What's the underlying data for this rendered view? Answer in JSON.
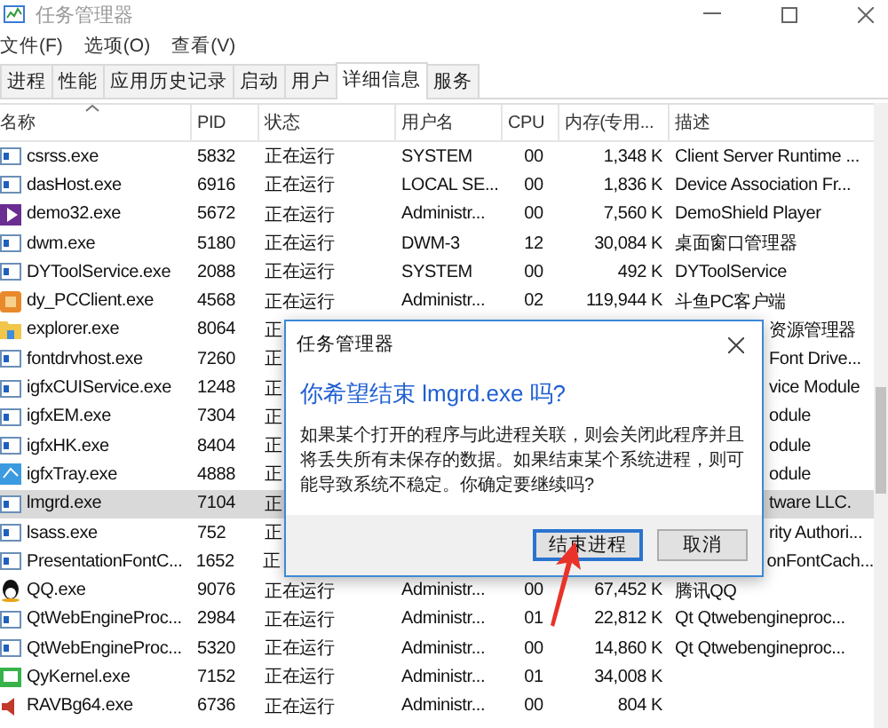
{
  "window": {
    "title": "任务管理器"
  },
  "menu": [
    "文件(F)",
    "选项(O)",
    "查看(V)"
  ],
  "tabs": [
    {
      "label": "进程",
      "selected": false
    },
    {
      "label": "性能",
      "selected": false
    },
    {
      "label": "应用历史记录",
      "selected": false
    },
    {
      "label": "启动",
      "selected": false
    },
    {
      "label": "用户",
      "selected": false
    },
    {
      "label": "详细信息",
      "selected": true
    },
    {
      "label": "服务",
      "selected": false
    }
  ],
  "table": {
    "columns": [
      "名称",
      "PID",
      "状态",
      "用户名",
      "CPU",
      "内存(专用...",
      "描述"
    ],
    "rows": [
      {
        "kind": "window",
        "name": "csrss.exe",
        "pid": "5832",
        "status": "正在运行",
        "user": "SYSTEM",
        "cpu": "00",
        "memory": "1,348 K",
        "description": "Client Server Runtime ...",
        "selected": false
      },
      {
        "kind": "window",
        "name": "dasHost.exe",
        "pid": "6916",
        "status": "正在运行",
        "user": "LOCAL SE...",
        "cpu": "00",
        "memory": "1,836 K",
        "description": "Device Association Fr...",
        "selected": false
      },
      {
        "kind": "play",
        "name": "demo32.exe",
        "pid": "5672",
        "status": "正在运行",
        "user": "Administr...",
        "cpu": "00",
        "memory": "7,560 K",
        "description": "DemoShield Player",
        "selected": false
      },
      {
        "kind": "window",
        "name": "dwm.exe",
        "pid": "5180",
        "status": "正在运行",
        "user": "DWM-3",
        "cpu": "12",
        "memory": "30,084 K",
        "description": "桌面窗口管理器",
        "selected": false
      },
      {
        "kind": "window",
        "name": "DYToolService.exe",
        "pid": "2088",
        "status": "正在运行",
        "user": "SYSTEM",
        "cpu": "00",
        "memory": "492 K",
        "description": "DYToolService",
        "selected": false
      },
      {
        "kind": "box",
        "name": "dy_PCClient.exe",
        "pid": "4568",
        "status": "正在运行",
        "user": "Administr...",
        "cpu": "02",
        "memory": "119,944 K",
        "description": "斗鱼PC客户端",
        "selected": false
      },
      {
        "kind": "folder",
        "name": "explorer.exe",
        "pid": "8064",
        "status": "正",
        "description": "资源管理器",
        "selected": false
      },
      {
        "kind": "window",
        "name": "fontdrvhost.exe",
        "pid": "7260",
        "status": "正",
        "description": "Font Drive...",
        "selected": false
      },
      {
        "kind": "window",
        "name": "igfxCUIService.exe",
        "pid": "1248",
        "status": "正",
        "description": "vice Module",
        "selected": false
      },
      {
        "kind": "window",
        "name": "igfxEM.exe",
        "pid": "7304",
        "status": "正",
        "description": "odule",
        "selected": false
      },
      {
        "kind": "window",
        "name": "igfxHK.exe",
        "pid": "8404",
        "status": "正",
        "description": "odule",
        "selected": false
      },
      {
        "kind": "monitor",
        "name": "igfxTray.exe",
        "pid": "4888",
        "status": "正",
        "description": "odule",
        "selected": false
      },
      {
        "kind": "window",
        "name": "lmgrd.exe",
        "pid": "7104",
        "status": "正",
        "description": "tware LLC.",
        "selected": true
      },
      {
        "kind": "window",
        "name": "lsass.exe",
        "pid": "752",
        "status": "正",
        "description": "rity Authori...",
        "selected": false
      },
      {
        "kind": "window",
        "name": "PresentationFontC...",
        "pid": "1652",
        "status": "正",
        "description": "onFontCach...",
        "selected": false
      },
      {
        "kind": "penguin",
        "name": "QQ.exe",
        "pid": "9076",
        "status": "正在运行",
        "user": "Administr...",
        "cpu": "00",
        "memory": "67,452 K",
        "description": "腾讯QQ",
        "selected": false
      },
      {
        "kind": "window",
        "name": "QtWebEngineProc...",
        "pid": "2984",
        "status": "正在运行",
        "user": "Administr...",
        "cpu": "01",
        "memory": "22,812 K",
        "description": "Qt Qtwebengineproc...",
        "selected": false
      },
      {
        "kind": "window",
        "name": "QtWebEngineProc...",
        "pid": "5320",
        "status": "正在运行",
        "user": "Administr...",
        "cpu": "00",
        "memory": "14,860 K",
        "description": "Qt Qtwebengineproc...",
        "selected": false
      },
      {
        "kind": "screen",
        "name": "QyKernel.exe",
        "pid": "7152",
        "status": "正在运行",
        "user": "Administr...",
        "cpu": "01",
        "memory": "34,008 K",
        "selected": false
      },
      {
        "kind": "speaker",
        "name": "RAVBg64.exe",
        "pid": "6736",
        "status": "正在运行",
        "user": "Administr...",
        "cpu": "00",
        "memory": "804 K",
        "selected": false
      }
    ]
  },
  "dialog": {
    "title": "任务管理器",
    "heading": "你希望结束 lmgrd.exe 吗?",
    "message": "如果某个打开的程序与此进程关联，则会关闭此程序并且将丢失所有未保存的数据。如果结束某个系统进程，则可能导致系统不稳定。你确定要继续吗?",
    "buttons": [
      {
        "label": "结束进程",
        "selected": true
      },
      {
        "label": "取消",
        "selected": false
      }
    ]
  }
}
